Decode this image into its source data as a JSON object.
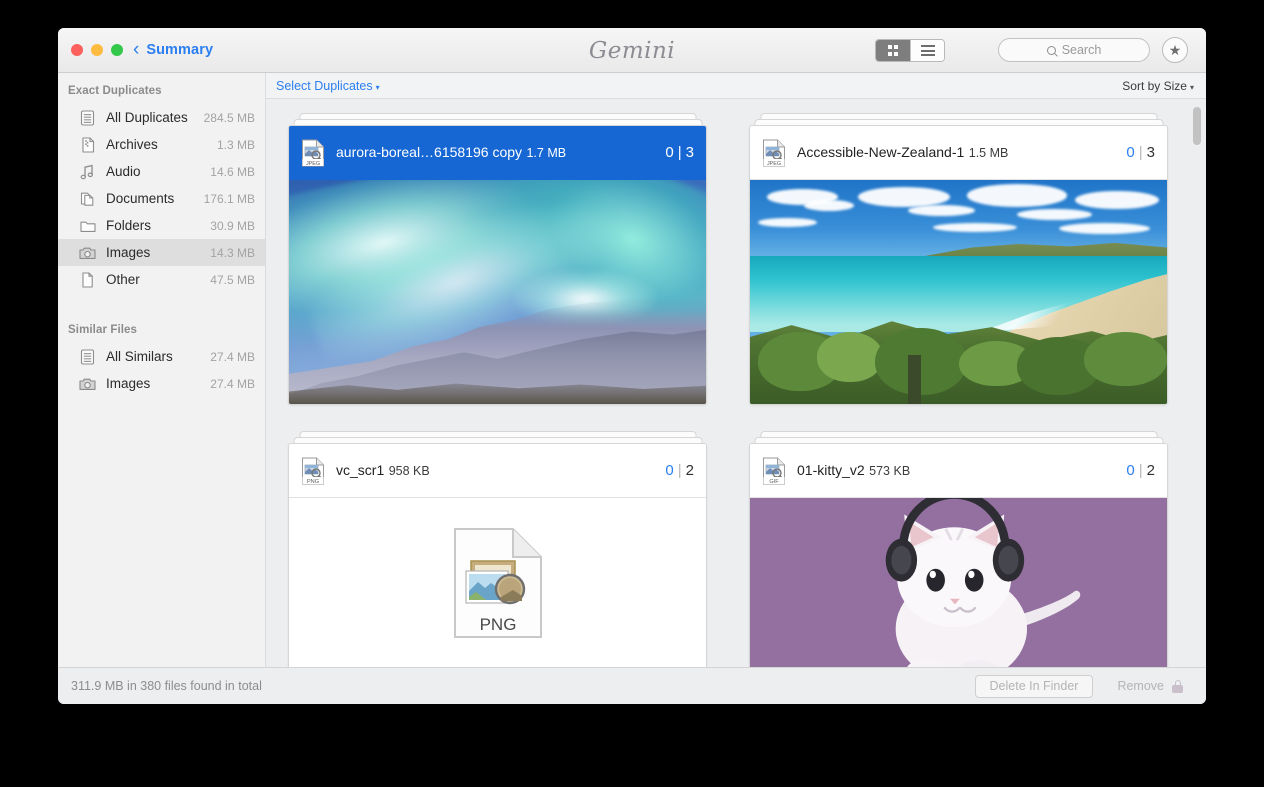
{
  "titlebar": {
    "back_label": "Summary",
    "back_icon": "chevron-left-icon",
    "brand": "Gemini",
    "view_grid_icon": "grid-view-icon",
    "view_list_icon": "list-view-icon",
    "search_icon": "search-icon",
    "search_placeholder": "Search",
    "search_value": "",
    "star_icon": "★",
    "traffic_close": "close-window-button",
    "traffic_minimize": "minimize-window-button",
    "traffic_zoom": "zoom-window-button"
  },
  "sidebar": {
    "sections": [
      {
        "title": "Exact Duplicates",
        "items": [
          {
            "label": "All Duplicates",
            "size": "284.5 MB",
            "icon": "stack-icon",
            "selected": false
          },
          {
            "label": "Archives",
            "size": "1.3 MB",
            "icon": "archive-icon",
            "selected": false
          },
          {
            "label": "Audio",
            "size": "14.6 MB",
            "icon": "music-note-icon",
            "selected": false
          },
          {
            "label": "Documents",
            "size": "176.1 MB",
            "icon": "documents-icon",
            "selected": false
          },
          {
            "label": "Folders",
            "size": "30.9 MB",
            "icon": "folder-icon",
            "selected": false
          },
          {
            "label": "Images",
            "size": "14.3 MB",
            "icon": "camera-icon",
            "selected": true
          },
          {
            "label": "Other",
            "size": "47.5 MB",
            "icon": "file-icon",
            "selected": false
          }
        ]
      },
      {
        "title": "Similar Files",
        "items": [
          {
            "label": "All Similars",
            "size": "27.4 MB",
            "icon": "stack-icon",
            "selected": false
          },
          {
            "label": "Images",
            "size": "27.4 MB",
            "icon": "camera-icon",
            "selected": false
          }
        ]
      }
    ]
  },
  "main_toolbar": {
    "select_duplicates": "Select Duplicates",
    "select_duplicates_caret": "▾",
    "sort_by": "Sort by Size",
    "sort_by_caret": "▾"
  },
  "cards": [
    {
      "name": "aurora-boreal…6158196 copy",
      "size": "1.7 MB",
      "format": "JPEG",
      "selected_count": "0",
      "separator": "|",
      "total_count": "3",
      "selected": true,
      "thumb": "aurora"
    },
    {
      "name": "Accessible-New-Zealand-1",
      "size": "1.5 MB",
      "format": "JPEG",
      "selected_count": "0",
      "separator": "|",
      "total_count": "3",
      "selected": false,
      "thumb": "newzealand"
    },
    {
      "name": "vc_scr1",
      "size": "958 KB",
      "format": "PNG",
      "selected_count": "0",
      "separator": "|",
      "total_count": "2",
      "selected": false,
      "thumb": "png-document",
      "thumb_label": "PNG"
    },
    {
      "name": "01-kitty_v2",
      "size": "573 KB",
      "format": "GIF",
      "selected_count": "0",
      "separator": "|",
      "total_count": "2",
      "selected": false,
      "thumb": "kitty"
    }
  ],
  "footer": {
    "status": "311.9 MB in 380 files found in total",
    "delete_label": "Delete In Finder",
    "remove_label": "Remove",
    "lock_icon": "lock-icon"
  },
  "colors": {
    "accent_blue": "#2b7ff0",
    "selected_card": "#1667d4",
    "kitty_background": "#9470a0",
    "sidebar_selected": "#dedede"
  }
}
